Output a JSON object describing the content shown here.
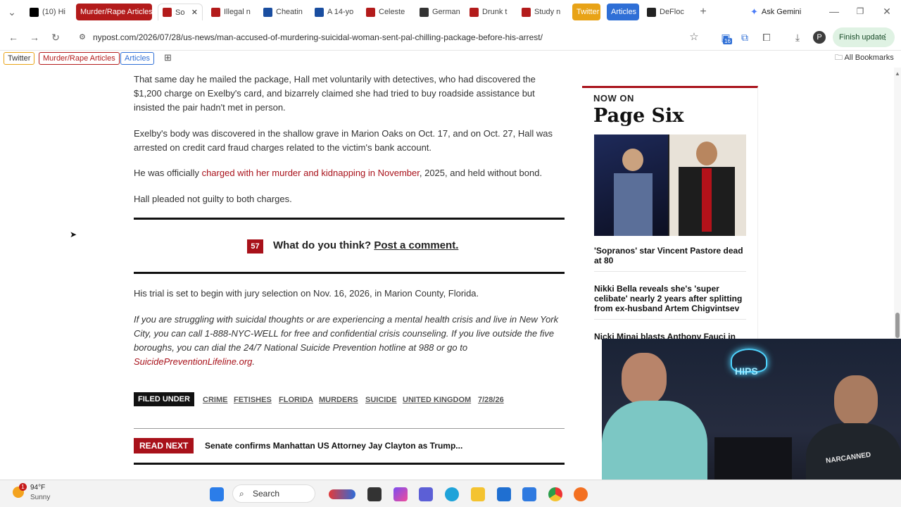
{
  "tabs": [
    {
      "label": "(10) Hi",
      "color": "#000000"
    },
    {
      "label": "Murder/Rape Articles",
      "color": "#b31b1b",
      "pill": true
    },
    {
      "label": "So",
      "color": "#b31b1b",
      "active": true
    },
    {
      "label": "Illegal n",
      "color": "#b31b1b"
    },
    {
      "label": "Cheatin",
      "color": "#1a4ea0"
    },
    {
      "label": "A 14-yo",
      "color": "#1a4ea0"
    },
    {
      "label": "Celeste",
      "color": "#b31b1b"
    },
    {
      "label": "German",
      "color": "#333333"
    },
    {
      "label": "Drunk t",
      "color": "#b31b1b"
    },
    {
      "label": "Study n",
      "color": "#b31b1b"
    },
    {
      "label": "Twitter",
      "color": "#e8a317",
      "pill": true
    },
    {
      "label": "Articles",
      "color": "#2f6fd6",
      "pill": true
    },
    {
      "label": "DeFloc",
      "color": "#222222"
    }
  ],
  "ask_gemini": "Ask Gemini",
  "url": "nypost.com/2026/07/28/us-news/man-accused-of-murdering-suicidal-woman-sent-pal-chilling-package-before-his-arrest/",
  "finish_update": "Finish update",
  "extension_badge": "16",
  "profile_initial": "P",
  "bookmarks": {
    "items": [
      "Twitter",
      "Murder/Rape Articles",
      "Articles"
    ],
    "all_bookmarks": "All Bookmarks"
  },
  "article": {
    "p1": "That same day he mailed the package, Hall met voluntarily with detectives, who had discovered the $1,200 charge on Exelby's card, and bizarrely claimed she had tried to buy roadside assistance but insisted the pair hadn't met in person.",
    "p2": "Exelby's body was discovered in the shallow grave in Marion Oaks on Oct. 17, and on Oct. 27, Hall was arrested on credit card fraud charges related to the victim's bank account.",
    "p3_pre": "He was officially ",
    "p3_link": "charged with her murder and kidnapping in November",
    "p3_post": ", 2025, and held without bond.",
    "p4": "Hall pleaded not guilty to both charges.",
    "comment_count": "57",
    "comment_question": "What do you think?",
    "comment_link": "Post a comment.",
    "p5": "His trial is set to begin with jury selection on Nov. 16, 2026, in Marion County, Florida.",
    "p6": "If you are struggling with suicidal thoughts or are experiencing a mental health crisis and live in New York City, you can call 1-888-NYC-WELL for free and confidential crisis counseling. If you live outside the five boroughs, you can dial the 24/7 National Suicide Prevention hotline at 988 or go to",
    "p6_link": "SuicidePreventionLifeline.org",
    "filed_under_label": "FILED UNDER",
    "filed_under": [
      "CRIME",
      "FETISHES",
      "FLORIDA",
      "MURDERS",
      "SUICIDE",
      "UNITED KINGDOM",
      "7/28/26"
    ],
    "read_next_label": "READ NEXT",
    "read_next_title": "Senate confirms Manhattan US Attorney Jay Clayton as Trump..."
  },
  "sidebar": {
    "now_on": "NOW ON",
    "brand": "Page Six",
    "headlines": [
      "'Sopranos' star Vincent Pastore dead at 80",
      "Nikki Bella reveals she's 'super celibate' nearly 2 years after splitting from ex-husband Artem Chigvintsev",
      "Nicki Minaj blasts Anthony Fauci in"
    ]
  },
  "webcam": {
    "neon_text": "HIPS",
    "shirt_text": "NARCANNED"
  },
  "taskbar": {
    "weather_temp": "94°F",
    "weather_desc": "Sunny",
    "weather_badge": "1",
    "search_label": "Search"
  }
}
